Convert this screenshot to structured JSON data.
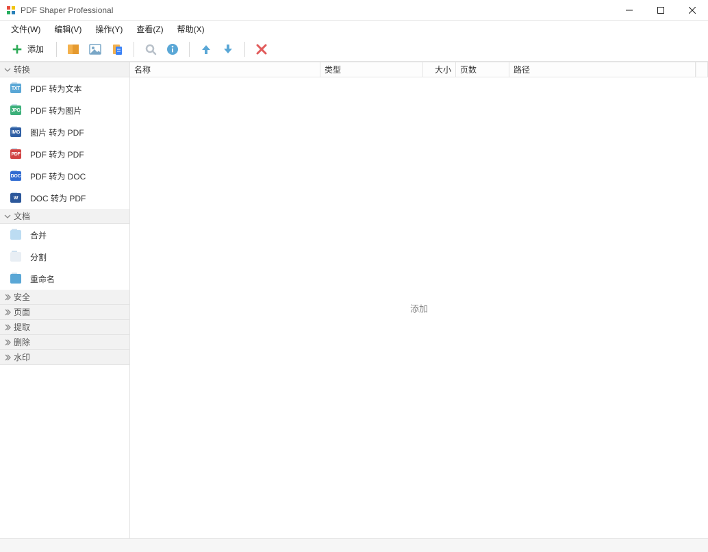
{
  "window": {
    "title": "PDF Shaper Professional"
  },
  "menu": {
    "file": "文件(W)",
    "edit": "编辑(V)",
    "action": "操作(Y)",
    "view": "查看(Z)",
    "help": "帮助(X)"
  },
  "toolbar": {
    "add_label": "添加"
  },
  "sidebar": {
    "groups": [
      {
        "title": "转换",
        "expanded": true,
        "items": [
          {
            "label": "PDF 转为文本",
            "tag": "TXT",
            "bg": "#5aa7d6"
          },
          {
            "label": "PDF 转为图片",
            "tag": "JPG",
            "bg": "#3cb07a"
          },
          {
            "label": "图片 转为 PDF",
            "tag": "IMG",
            "bg": "#2f5fa4"
          },
          {
            "label": "PDF 转为 PDF",
            "tag": "PDF",
            "bg": "#d14343"
          },
          {
            "label": "PDF 转为 DOC",
            "tag": "DOC",
            "bg": "#2f6bd1"
          },
          {
            "label": "DOC 转为 PDF",
            "tag": "W",
            "bg": "#2b579a"
          }
        ]
      },
      {
        "title": "文档",
        "expanded": true,
        "items": [
          {
            "label": "合并",
            "tag": "",
            "bg": "#bcdcf2"
          },
          {
            "label": "分割",
            "tag": "",
            "bg": "#e8eef4"
          },
          {
            "label": "重命名",
            "tag": "",
            "bg": "#5aa7d6"
          }
        ]
      },
      {
        "title": "安全",
        "expanded": false,
        "items": []
      },
      {
        "title": "页面",
        "expanded": false,
        "items": []
      },
      {
        "title": "提取",
        "expanded": false,
        "items": []
      },
      {
        "title": "删除",
        "expanded": false,
        "items": []
      },
      {
        "title": "水印",
        "expanded": false,
        "items": []
      }
    ]
  },
  "list": {
    "columns": {
      "name": "名称",
      "type": "类型",
      "size": "大小",
      "pages": "页数",
      "path": "路径"
    },
    "placeholder": "添加"
  }
}
